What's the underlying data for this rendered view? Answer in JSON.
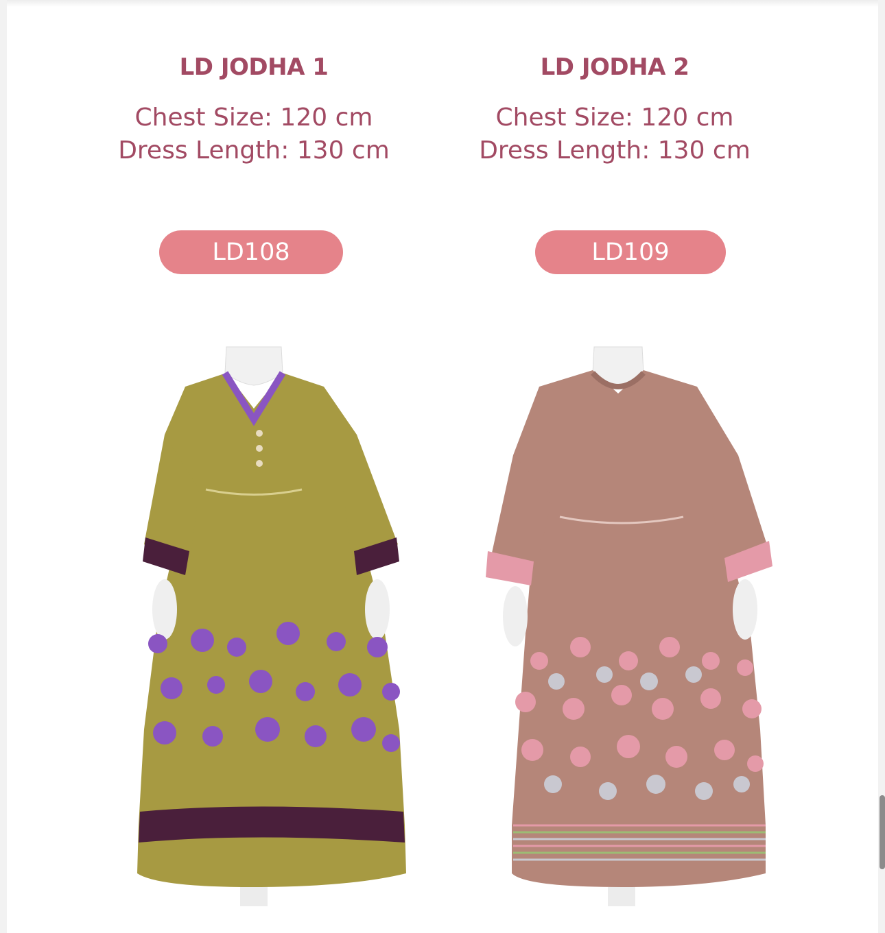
{
  "products": [
    {
      "title": "LD JODHA 1",
      "chest": "Chest Size: 120 cm",
      "length": "Dress Length: 130 cm",
      "code": "LD108",
      "photo_alt": "LD108",
      "dress_color": "#a79a42",
      "flower_color": "#8a55c2",
      "border_color": "#4a1f3b"
    },
    {
      "title": "LD JODHA 2",
      "chest": "Chest Size: 120 cm",
      "length": "Dress Length: 130 cm",
      "code": "LD109",
      "photo_alt": "LD109",
      "dress_color": "#b58679",
      "flower_color": "#e49aa8",
      "border_color": "#c9c8d0"
    }
  ],
  "colors": {
    "title": "#a24a63",
    "button": "#e5838a"
  }
}
